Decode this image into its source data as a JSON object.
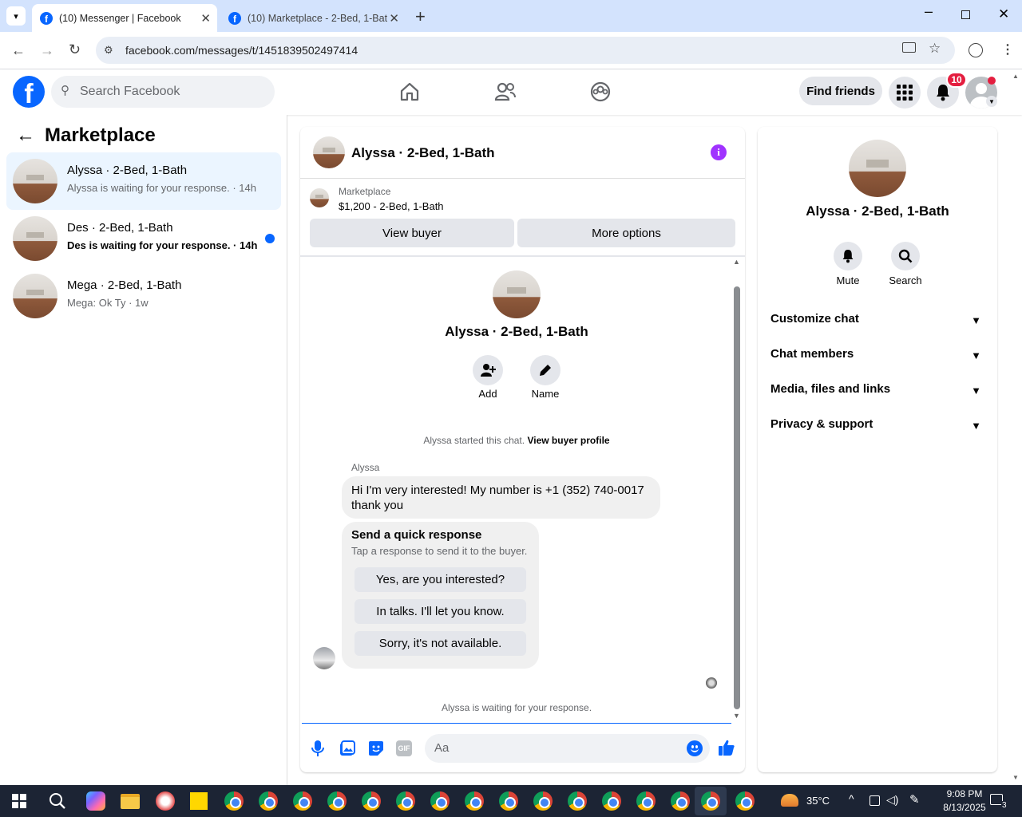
{
  "browser": {
    "tabs": [
      {
        "title": "(10) Messenger | Facebook"
      },
      {
        "title": "(10) Marketplace - 2-Bed, 1-Bat"
      }
    ],
    "url": "facebook.com/messages/t/1451839502497414"
  },
  "fb_header": {
    "search_placeholder": "Search Facebook",
    "find_friends": "Find friends",
    "notification_count": "10"
  },
  "left": {
    "title": "Marketplace",
    "conversations": [
      {
        "name": "Alyssa · 2-Bed, 1-Bath",
        "preview": "Alyssa is waiting for your response. · 14h"
      },
      {
        "name": "Des · 2-Bed, 1-Bath",
        "preview": "Des is waiting for your response. · 14h"
      },
      {
        "name": "Mega · 2-Bed, 1-Bath",
        "preview": "Mega: Ok Ty · 1w"
      }
    ]
  },
  "chat": {
    "title": "Alyssa · 2-Bed, 1-Bath",
    "listing_source": "Marketplace",
    "listing": "$1,200 - 2-Bed, 1-Bath",
    "view_buyer": "View buyer",
    "more_options": "More options",
    "profile_name": "Alyssa · 2-Bed, 1-Bath",
    "add_label": "Add",
    "name_label": "Name",
    "started_text": "Alyssa started this chat.",
    "view_buyer_profile": "View buyer profile",
    "sender": "Alyssa",
    "message": "Hi I'm very interested! My number is +1 (352) 740-0017 thank you",
    "quick_title": "Send a quick response",
    "quick_sub": "Tap a response to send it to the buyer.",
    "quick_replies": [
      "Yes, are you interested?",
      "In talks. I'll let you know.",
      "Sorry, it's not available."
    ],
    "waiting": "Alyssa is waiting for your response.",
    "input_placeholder": "Aa"
  },
  "details": {
    "name": "Alyssa · 2-Bed, 1-Bath",
    "mute": "Mute",
    "search": "Search",
    "sections": [
      "Customize chat",
      "Chat members",
      "Media, files and links",
      "Privacy & support"
    ]
  },
  "taskbar": {
    "temperature": "35°C",
    "time": "9:08 PM",
    "date": "8/13/2025",
    "notif": "3"
  },
  "colors": {
    "fb_blue": "#0866ff",
    "messenger_purple": "#a033ff",
    "unread_dot": "#0866ff",
    "badge_red": "#e41e3f"
  }
}
